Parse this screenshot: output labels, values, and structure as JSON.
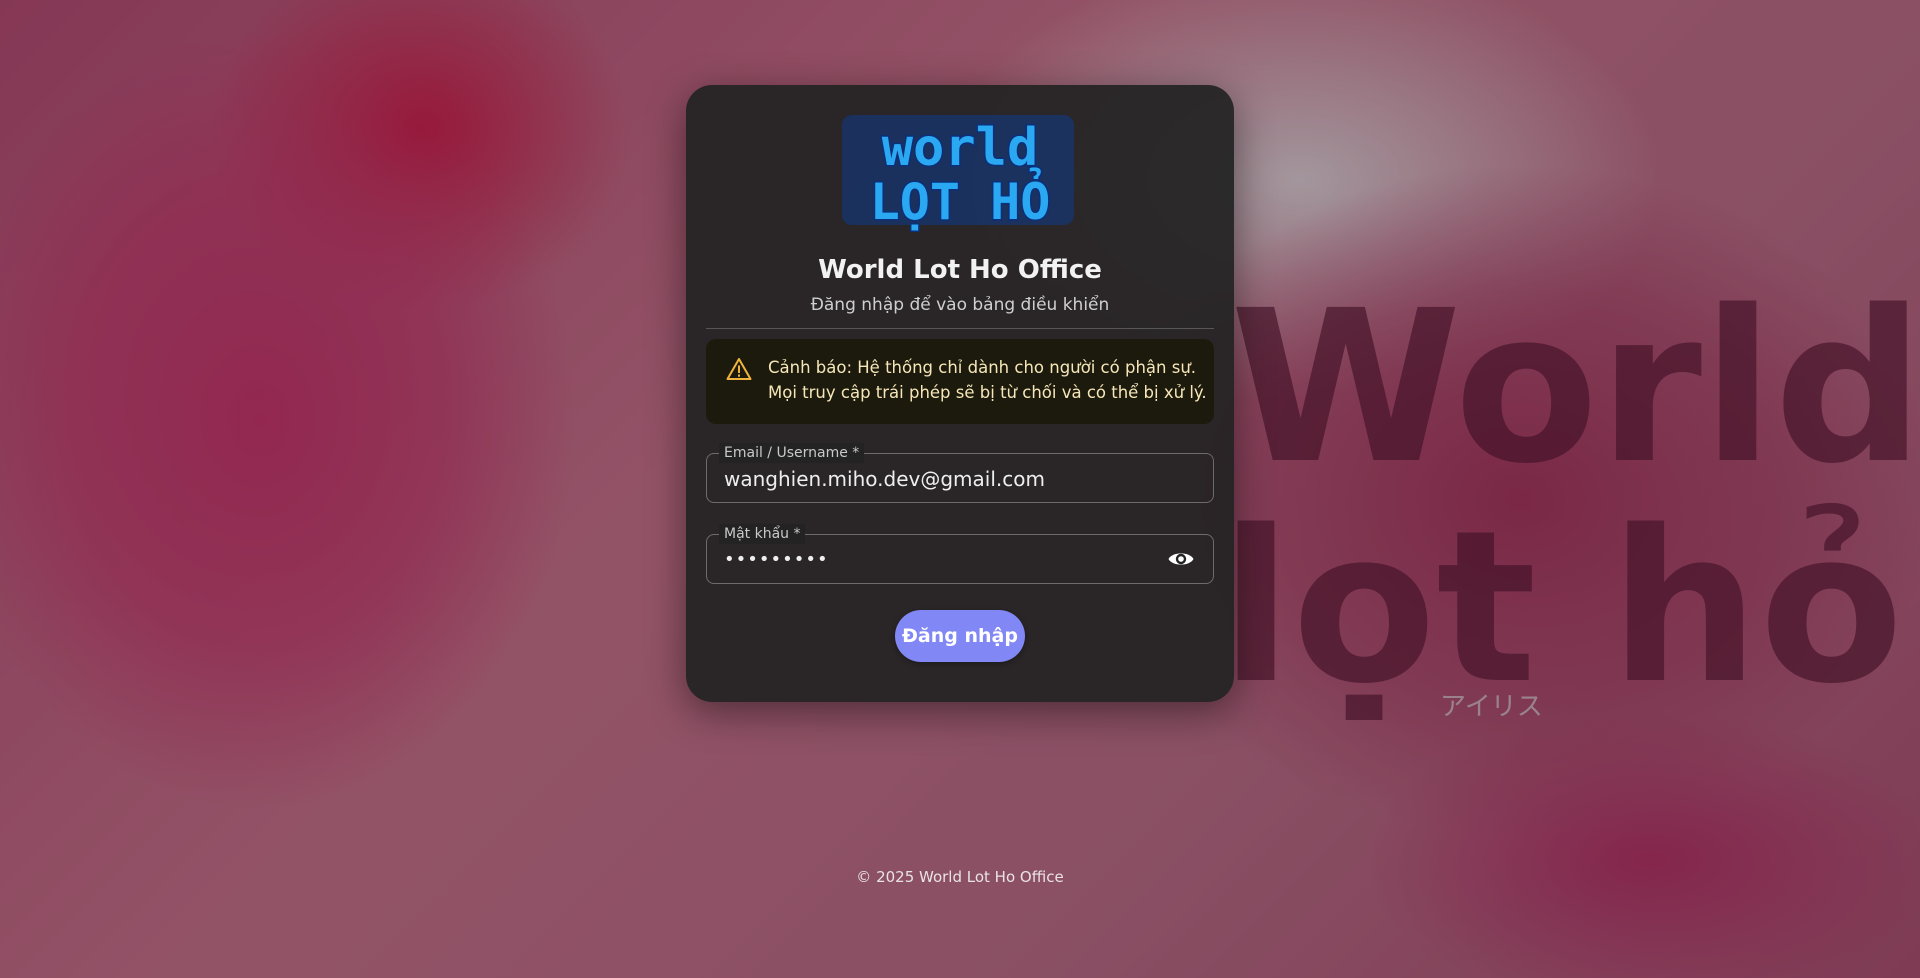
{
  "app": {
    "title": "World Lot Ho Office",
    "subtitle": "Đăng nhập để vào bảng điều khiển",
    "logo_text_line1": "world",
    "logo_text_line2": "LỌT HỎ"
  },
  "warning": {
    "icon": "warning-triangle-icon",
    "line1": "Cảnh báo: Hệ thống chỉ dành cho người có phận sự.",
    "line2": "Mọi truy cập trái phép sẽ bị từ chối và có thể bị xử lý.",
    "color": "#f0b43c"
  },
  "form": {
    "email_label": "Email / Username *",
    "email_value": "wanghien.miho.dev@gmail.com",
    "password_label": "Mật khẩu *",
    "password_value": "•••••••••",
    "password_toggle_icon": "eye-icon",
    "submit_label": "Đăng nhập"
  },
  "footer": {
    "copyright": "© 2025 World Lot Ho Office"
  },
  "background": {
    "wordmark_line1": "World",
    "wordmark_line2": "lọt hỏ",
    "wordmark_caption": "アイリス"
  },
  "colors": {
    "accent": "#8187f4",
    "card_background": "#222222",
    "warning_background": "#1c1a0d",
    "logo_blue": "#2aa8f2"
  }
}
